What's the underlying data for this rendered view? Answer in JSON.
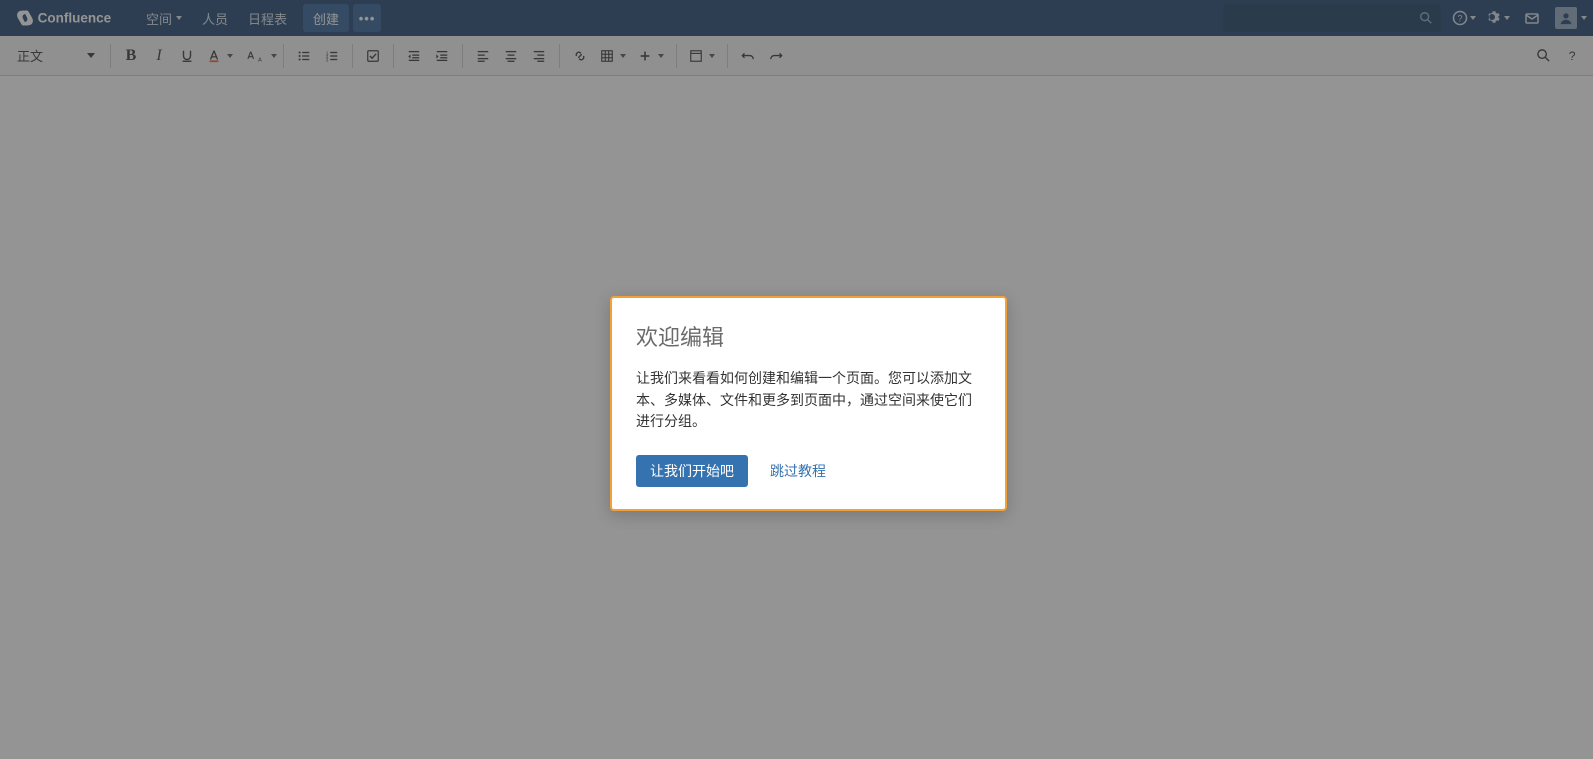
{
  "header": {
    "product": "Confluence",
    "nav": {
      "spaces": "空间",
      "people": "人员",
      "calendars": "日程表"
    },
    "create": "创建",
    "more": "•••"
  },
  "toolbar": {
    "paragraph": "正文",
    "bold": "B",
    "italic": "I"
  },
  "dialog": {
    "title": "欢迎编辑",
    "body": "让我们来看看如何创建和编辑一个页面。您可以添加文本、多媒体、文件和更多到页面中，通过空间来使它们进行分组。",
    "start": "让我们开始吧",
    "skip": "跳过教程"
  }
}
